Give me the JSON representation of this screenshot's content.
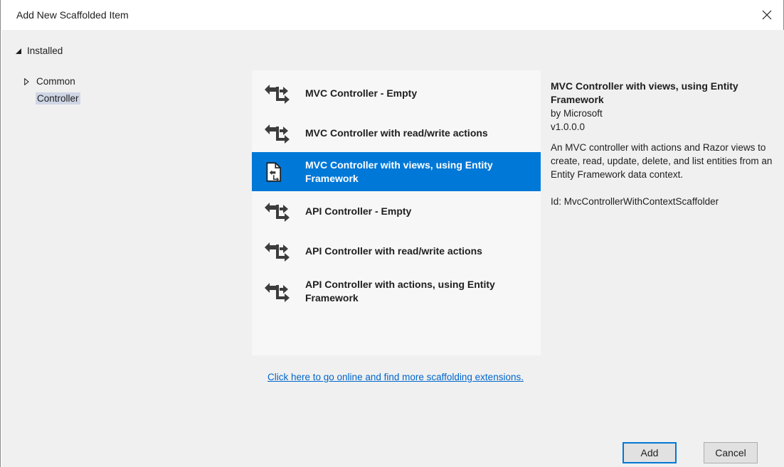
{
  "dialog": {
    "title": "Add New Scaffolded Item",
    "close_icon": "close-icon"
  },
  "tree": {
    "installed_label": "Installed",
    "items": [
      {
        "label": "Common",
        "expanded": false
      },
      {
        "label": "Controller",
        "selected": true
      }
    ]
  },
  "scaffolders": [
    {
      "label": "MVC Controller - Empty",
      "icon": "controller-icon",
      "selected": false
    },
    {
      "label": "MVC Controller with read/write actions",
      "icon": "controller-icon",
      "selected": false
    },
    {
      "label": "MVC Controller with views, using Entity Framework",
      "icon": "controller-views-icon",
      "selected": true
    },
    {
      "label": "API Controller - Empty",
      "icon": "controller-icon",
      "selected": false
    },
    {
      "label": "API Controller with read/write actions",
      "icon": "controller-icon",
      "selected": false
    },
    {
      "label": "API Controller with actions, using Entity Framework",
      "icon": "controller-icon",
      "selected": false
    }
  ],
  "online_link": "Click here to go online and find more scaffolding extensions.",
  "details": {
    "title": "MVC Controller with views, using Entity Framework",
    "author": "by Microsoft",
    "version": "v1.0.0.0",
    "description": "An MVC controller with actions and Razor views to create, read, update, delete, and list entities from an Entity Framework data context.",
    "id_text": "Id: MvcControllerWithContextScaffolder"
  },
  "buttons": {
    "add": "Add",
    "cancel": "Cancel"
  },
  "colors": {
    "accent": "#0078d7",
    "link": "#0066cc",
    "dialog_bg": "#f0f0f0"
  }
}
